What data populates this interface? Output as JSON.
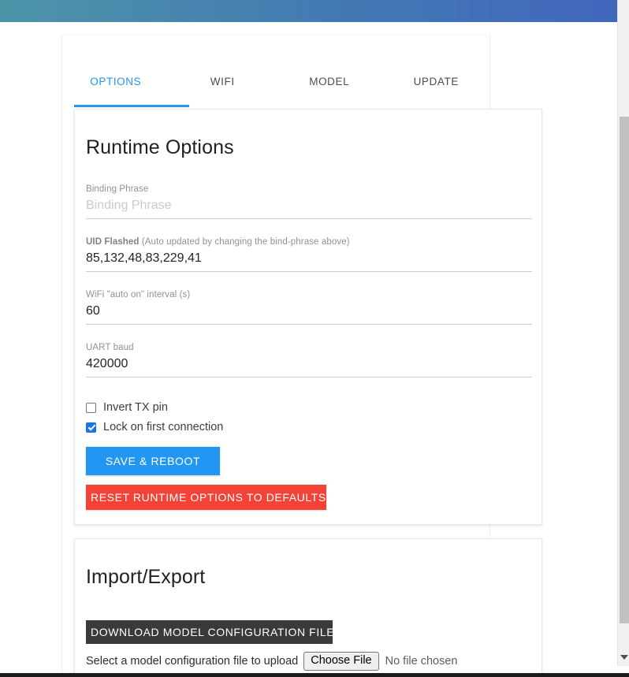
{
  "header": {
    "gradient_left": "#4d94a8",
    "gradient_right": "#4167bd"
  },
  "tabs": [
    {
      "label": "OPTIONS",
      "active": true
    },
    {
      "label": "WIFI",
      "active": false
    },
    {
      "label": "MODEL",
      "active": false
    },
    {
      "label": "UPDATE",
      "active": false
    }
  ],
  "runtime_card": {
    "title": "Runtime Options",
    "fields": [
      {
        "label": "Binding Phrase",
        "label_bold": "",
        "label_rest": "",
        "value": "",
        "placeholder": "Binding Phrase"
      },
      {
        "label_bold": "UID Flashed",
        "label_rest": " (Auto updated by changing the bind-phrase above)",
        "value": "85,132,48,83,229,41",
        "placeholder": ""
      },
      {
        "label": "WiFi \"auto on\" interval (s)",
        "value": "60",
        "placeholder": ""
      },
      {
        "label": "UART baud",
        "value": "420000",
        "placeholder": ""
      }
    ],
    "checkboxes": [
      {
        "label": "Invert TX pin",
        "checked": false
      },
      {
        "label": "Lock on first connection",
        "checked": true
      }
    ],
    "buttons": {
      "save": "SAVE & REBOOT",
      "reset": "RESET RUNTIME OPTIONS TO DEFAULTS",
      "save_color": "#2196f3",
      "reset_color": "#f44336"
    }
  },
  "import_card": {
    "title": "Import/Export",
    "download_button": "DOWNLOAD MODEL CONFIGURATION FILE",
    "download_color": "#3a3a3a",
    "upload_label": "Select a model configuration file to upload",
    "choose_file_button": "Choose File",
    "no_file_text": "No file chosen"
  },
  "scrollbar": {
    "arrow_down_icon": "chevron-down-icon"
  }
}
